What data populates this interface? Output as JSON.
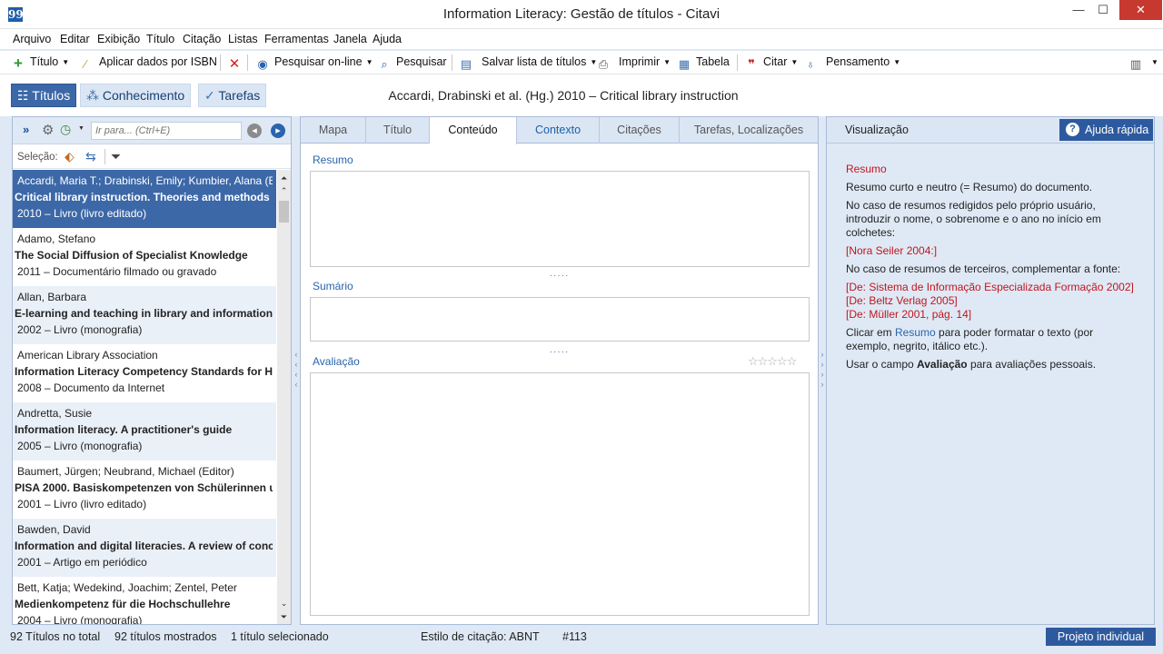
{
  "window": {
    "title": "Information Literacy: Gestão de títulos - Citavi",
    "minimize": "—",
    "maximize": "☐",
    "close": "✕"
  },
  "menu": [
    "Arquivo",
    "Editar",
    "Exibição",
    "Título",
    "Citação",
    "Listas",
    "Ferramentas",
    "Janela",
    "Ajuda"
  ],
  "toolbar": {
    "titulo": "Título",
    "isbn": "Aplicar dados por ISBN",
    "pesquisar_online": "Pesquisar on-line",
    "pesquisar": "Pesquisar",
    "salvar": "Salvar lista de títulos",
    "imprimir": "Imprimir",
    "tabela": "Tabela",
    "citar": "Citar",
    "pensamento": "Pensamento"
  },
  "nav": {
    "titulos": "Títulos",
    "conhecimento": "Conhecimento",
    "tarefas": "Tarefas"
  },
  "current_title": "Accardi, Drabinski et al. (Hg.) 2010 – Critical library instruction",
  "search": {
    "placeholder": "Ir para... (Ctrl+E)"
  },
  "selection_label": "Seleção:",
  "references": [
    {
      "authors": "Accardi, Maria T.; Drabinski, Emily; Kumbier, Alana (E",
      "title": "Critical library instruction. Theories and methods",
      "year": "2010 – Livro (livro editado)"
    },
    {
      "authors": "Adamo, Stefano",
      "title": "The Social Diffusion of Specialist Knowledge",
      "year": "2011 – Documentário filmado ou gravado"
    },
    {
      "authors": "Allan, Barbara",
      "title": "E-learning and teaching in library and information s",
      "year": "2002 – Livro (monografia)"
    },
    {
      "authors": "American Library Association",
      "title": "Information Literacy Competency Standards for Hi",
      "year": "2008 – Documento da Internet"
    },
    {
      "authors": "Andretta, Susie",
      "title": "Information literacy. A practitioner's guide",
      "year": "2005 – Livro (monografia)"
    },
    {
      "authors": "Baumert, Jürgen; Neubrand, Michael (Editor)",
      "title": "PISA 2000. Basiskompetenzen von Schülerinnen un",
      "year": "2001 – Livro (livro editado)"
    },
    {
      "authors": "Bawden, David",
      "title": "Information and digital literacies. A review of conc",
      "year": "2001 – Artigo em periódico"
    },
    {
      "authors": "Bett, Katja; Wedekind, Joachim; Zentel, Peter",
      "title": "Medienkompetenz für die Hochschullehre",
      "year": "2004 – Livro (monografia)"
    }
  ],
  "tabs": [
    "Mapa",
    "Título",
    "Conteúdo",
    "Contexto",
    "Citações",
    "Tarefas, Localizações"
  ],
  "fields": {
    "resumo": "Resumo",
    "sumario": "Sumário",
    "avaliacao": "Avaliação",
    "stars": "☆☆☆☆☆",
    "dots": "·····"
  },
  "preview": {
    "header": "Visualização",
    "help_button": "Ajuda rápida",
    "heading": "Resumo",
    "p1": "Resumo curto e neutro (= Resumo) do documento.",
    "p2": "No caso de resumos redigidos pelo próprio usuário, introduzir o nome, o sobrenome e o ano no início em colchetes:",
    "example1": "[Nora Seiler 2004:]",
    "p3": "No caso de resumos de terceiros, complementar a fonte:",
    "ex2a": "[De: Sistema de Informação Especializada Formação 2002]",
    "ex2b": "[De: Beltz Verlag 2005]",
    "ex2c": "[De: Müller 2001, pág. 14]",
    "p4_pre": "Clicar em ",
    "p4_link": "Resumo",
    "p4_post": " para poder formatar o texto (por exemplo, negrito, itálico etc.).",
    "p5_pre": "Usar o campo ",
    "p5_bold": "Avaliação",
    "p5_post": " para avaliações pessoais."
  },
  "status": {
    "total": "92 Títulos no total",
    "shown": "92 títulos mostrados",
    "selected": "1 título selecionado",
    "style": "Estilo de citação: ABNT",
    "number": "#113",
    "project": "Projeto individual"
  },
  "colors": {
    "accent": "#2d5a9e",
    "selected_row": "#3c68a8",
    "panel_bg": "#dfe9f5",
    "red_text": "#c0161e"
  },
  "icons": [
    "app-icon",
    "add-icon",
    "wand-icon",
    "delete-icon",
    "search-online-icon",
    "search-icon",
    "save-list-icon",
    "print-icon",
    "table-icon",
    "cite-icon",
    "idea-icon",
    "layout-icon",
    "books-icon",
    "knowledge-icon",
    "tasks-icon"
  ]
}
